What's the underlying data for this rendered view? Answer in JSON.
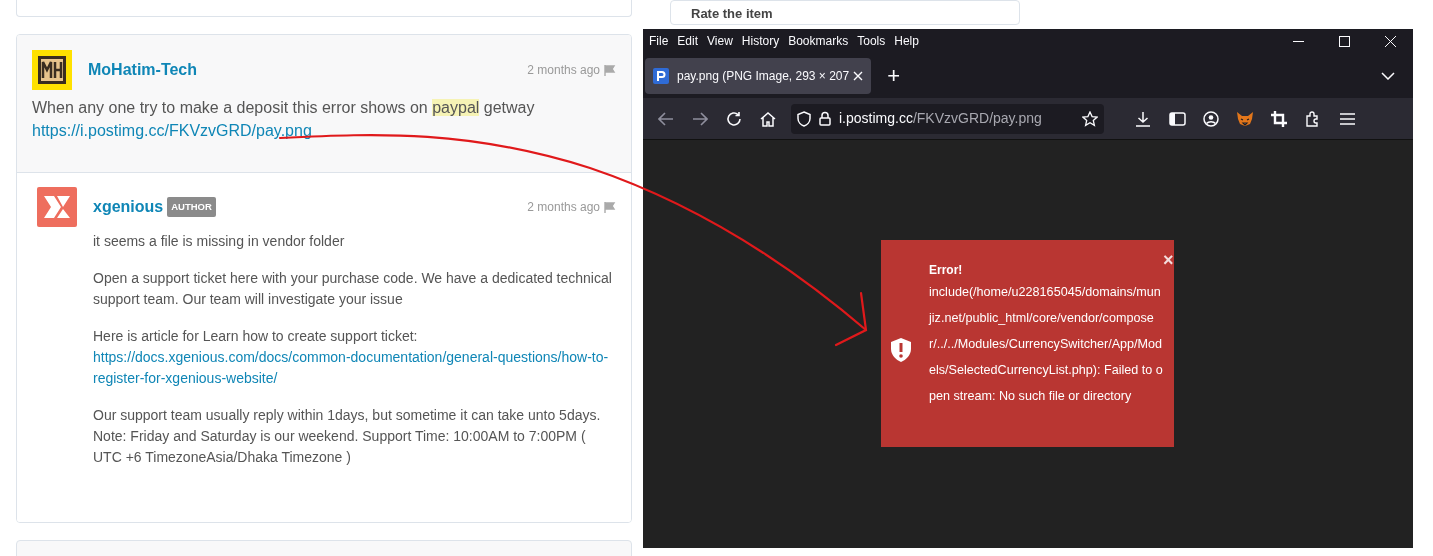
{
  "top_card": {
    "title": "Rate the item"
  },
  "comment": {
    "author": "MoHatim-Tech",
    "time": "2 months ago",
    "text_before": "When any one try to make a deposit this error shows on",
    "highlight": "paypal",
    "text_after": "getway",
    "link": "https://i.postimg.cc/FKVzvGRD/pay.png"
  },
  "reply": {
    "author": "xgenious",
    "badge": "AUTHOR",
    "time": "2 months ago",
    "paragraphs": [
      {
        "kind": "text",
        "text": "it seems a file is missing in vendor folder"
      },
      {
        "kind": "text",
        "text": "Open a support ticket here with your purchase code. We have a dedicated technical support team. Our team will investigate your issue"
      },
      {
        "kind": "link",
        "text": "Here is article for Learn how to create support ticket:",
        "link": "https://docs.xgenious.com/docs/common-documentation/general-questions/how-to-register-for-xgenious-website/"
      },
      {
        "kind": "text",
        "text": "Our support team usually reply within 1days, but sometime it can take unto 5days. Note: Friday and Saturday is our weekend. Support Time: 10:00AM to 7:00PM ( UTC +6 TimezoneAsia/Dhaka Timezone )"
      }
    ]
  },
  "browser": {
    "menu": [
      "File",
      "Edit",
      "View",
      "History",
      "Bookmarks",
      "Tools",
      "Help"
    ],
    "tabs": [
      {
        "title": "pay.png (PNG Image, 293 × 207",
        "selected": true
      }
    ],
    "new_tab": "+",
    "url": {
      "host": "i.postimg.cc",
      "path": "/FKVzvGRD/pay.png"
    },
    "error": {
      "title": "Error!",
      "message": "include(/home/u228165045/domains/munjiz.net/public_html/core/vendor/composer/../../Modules/CurrencySwitcher/App/Models/SelectedCurrencyList.php): Failed to open stream: No such file or directory",
      "close": "×"
    }
  }
}
